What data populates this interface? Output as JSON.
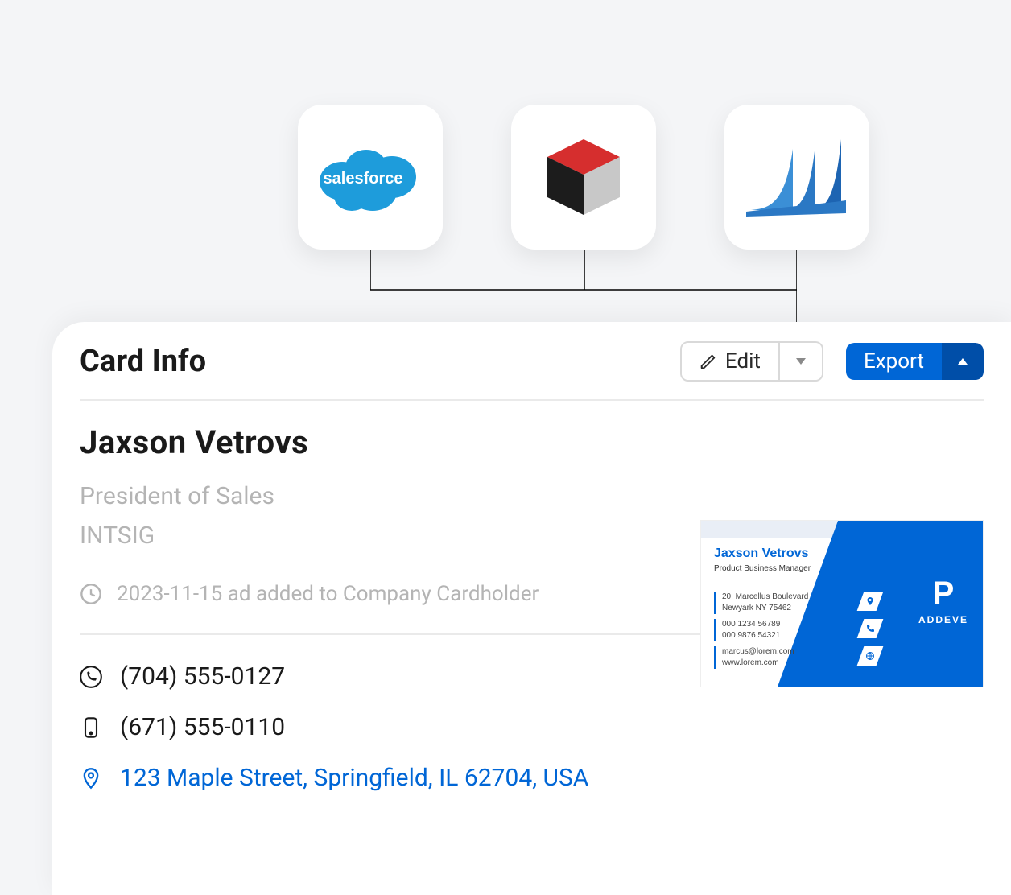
{
  "integrations": {
    "salesforce_label": "salesforce"
  },
  "header": {
    "title": "Card Info",
    "edit_label": "Edit",
    "export_label": "Export"
  },
  "contact": {
    "name": "Jaxson Vetrovs",
    "title": "President of Sales",
    "company": "INTSIG",
    "timestamp_text": "2023-11-15 ad added to Company Cardholder",
    "phone_cell": "(704) 555-0127",
    "phone_office": "(671) 555-0110",
    "address": "123 Maple Street, Springfield, IL 62704, USA"
  },
  "business_card": {
    "name": "Jaxson Vetrovs",
    "role": "Product Business Manager",
    "addr_line1": "20, Marcellus Boulevard",
    "addr_line2": "Newyark NY 75462",
    "phone1": "000 1234 56789",
    "phone2": "000 9876 54321",
    "email": "marcus@lorem.com",
    "web": "www.lorem.com",
    "brand_name": "ADDEVE"
  }
}
